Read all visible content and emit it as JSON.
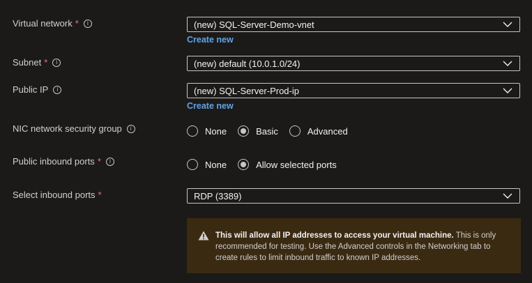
{
  "fields": {
    "virtual_network": {
      "label": "Virtual network",
      "required": "*",
      "value": "(new) SQL-Server-Demo-vnet",
      "link": "Create new"
    },
    "subnet": {
      "label": "Subnet",
      "required": "*",
      "value": "(new) default (10.0.1.0/24)"
    },
    "public_ip": {
      "label": "Public IP",
      "value": "(new) SQL-Server-Prod-ip",
      "link": "Create new"
    },
    "nic_nsg": {
      "label": "NIC network security group",
      "options": [
        "None",
        "Basic",
        "Advanced"
      ],
      "selected": "Basic"
    },
    "public_inbound_ports": {
      "label": "Public inbound ports",
      "required": "*",
      "options": [
        "None",
        "Allow selected ports"
      ],
      "selected": "Allow selected ports"
    },
    "select_inbound_ports": {
      "label": "Select inbound ports",
      "required": "*",
      "value": "RDP (3389)"
    }
  },
  "warning": {
    "bold": "This will allow all IP addresses to access your virtual machine.",
    "text": " This is only recommended for testing.  Use the Advanced controls in the Networking tab to create rules to limit inbound traffic to known IP addresses."
  },
  "colors": {
    "background": "#1b1a19",
    "link": "#5fa3e8",
    "required": "#f1707b",
    "warning_bg": "#3a2a12"
  },
  "icons": {
    "info": "info-icon",
    "chevron": "chevron-down-icon",
    "warning": "warning-icon"
  }
}
